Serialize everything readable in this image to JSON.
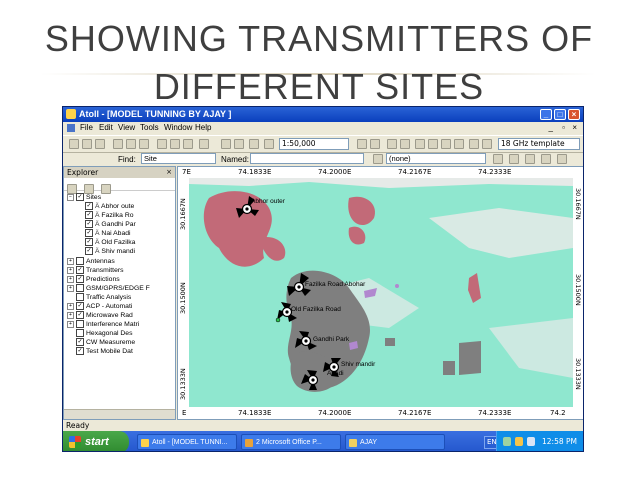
{
  "slide": {
    "title_line1": "SHOWING TRANSMITTERS OF",
    "title_line2": "DIFFERENT SITES"
  },
  "window": {
    "title": "Atoll - [MODEL TUNNING BY AJAY ]",
    "menu": [
      "File",
      "Edit",
      "View",
      "Tools",
      "Window",
      "Help"
    ]
  },
  "toolbar": {
    "scale_value": "1:50,000",
    "template_value": "18 GHz template",
    "find_label": "Find:",
    "find_value": "Site",
    "named_label": "Named:",
    "named_value": "",
    "filter_value": "(none)"
  },
  "explorer": {
    "title": "Explorer",
    "sites_label": "Sites",
    "sites": [
      "Abhor oute",
      "Fazilka Ro",
      "Gandhi Par",
      "Nai Abadi",
      "Old Fazilka",
      "Shiv mandi"
    ],
    "folders": [
      {
        "label": "Antennas",
        "checked": false
      },
      {
        "label": "Transmitters",
        "checked": true
      },
      {
        "label": "Predictions",
        "checked": true
      },
      {
        "label": "GSM/GPRS/EDGE F",
        "checked": false
      },
      {
        "label": "Traffic Analysis",
        "checked": false
      },
      {
        "label": "ACP - Automati",
        "checked": true
      },
      {
        "label": "Microwave Rad",
        "checked": true
      },
      {
        "label": "Interference Matri",
        "checked": false
      },
      {
        "label": "Hexagonal Des",
        "checked": false
      },
      {
        "label": "CW Measureme",
        "checked": true
      },
      {
        "label": "Test Mobile Dat",
        "checked": true
      }
    ]
  },
  "map": {
    "top_ticks": [
      "7E",
      "74.1833E",
      "74.2000E",
      "74.2167E",
      "74.2333E"
    ],
    "bottom_ticks": [
      "E",
      "74.1833E",
      "74.2000E",
      "74.2167E",
      "74.2333E",
      "74.2"
    ],
    "left_ticks": [
      "30.1667N",
      "30.1500N",
      "30.1333N"
    ],
    "right_ticks": [
      "30.1667N",
      "30.1500N",
      "30.1333N"
    ],
    "site_labels": {
      "abhor": "Abhor outer",
      "fazilka_road": "Fazilka Road Abohar",
      "old_fazilka": "Old Fazilka Road",
      "gandhi": "Gandhi Park",
      "shiv": "Shiv mandir",
      "nai": "Abadi"
    },
    "colors": {
      "terrain": "#8fe7cf",
      "built_up": "#7f7f7f",
      "residential": "#c26a78",
      "light_area": "#e6eae8",
      "accent_purple": "#b188cf"
    }
  },
  "status": {
    "text": "Ready"
  },
  "taskbar": {
    "start_label": "start",
    "tasks": [
      "Atoll - [MODEL TUNNI...",
      "2 Microsoft Office P...",
      "AJAY"
    ],
    "language": "EN",
    "clock": "12:58 PM"
  }
}
